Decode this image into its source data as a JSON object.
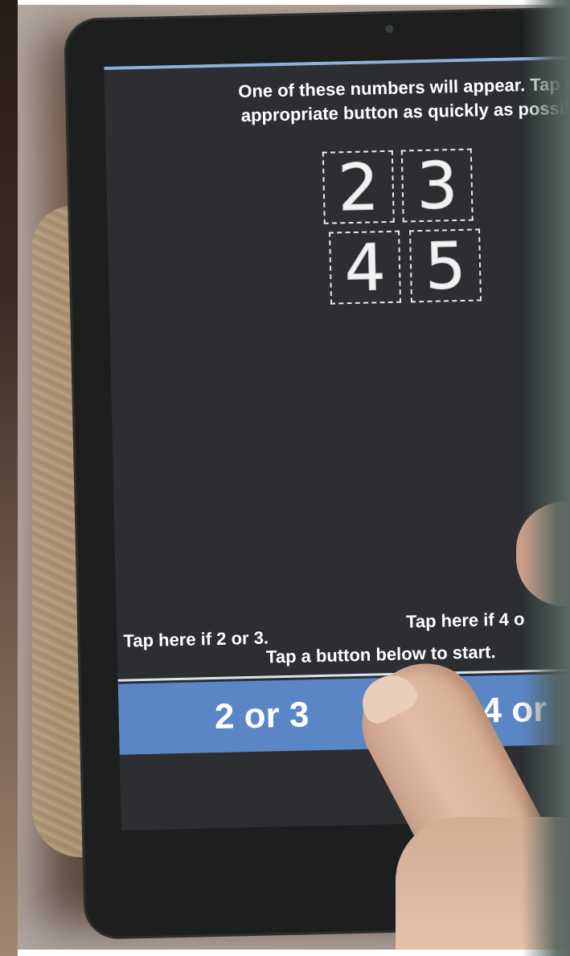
{
  "screen": {
    "instructions_line1": "One of these numbers will appear. Tap th",
    "instructions_line2": "appropriate button as quickly as possibl",
    "digits": [
      "2",
      "3",
      "4",
      "5"
    ],
    "tap_left_label": "Tap here if 2 or 3.",
    "tap_right_label": "Tap here if 4 o",
    "start_hint": "Tap a button below to start.",
    "button_left_label": "2 or 3",
    "button_right_label": "4 or"
  },
  "colors": {
    "screen_background": "#2c2e31",
    "button_blue": "#5b86c6",
    "text": "#ffffff"
  }
}
